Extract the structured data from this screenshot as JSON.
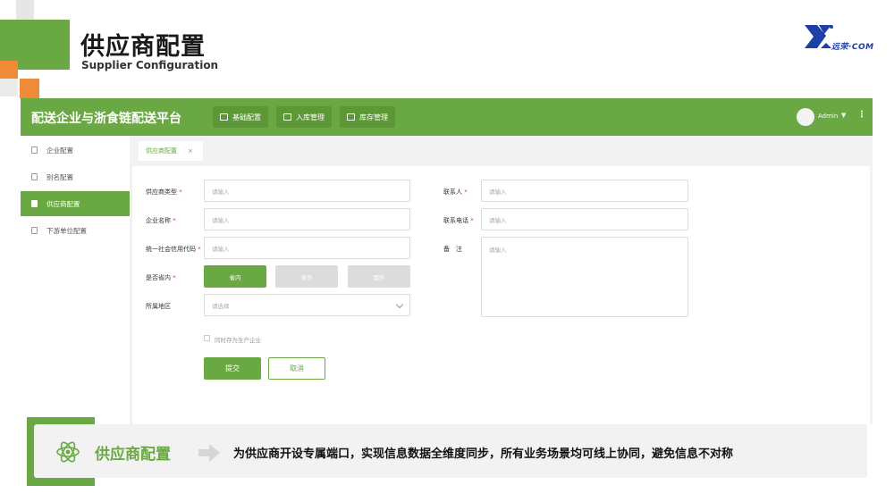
{
  "slide": {
    "title": "供应商配置",
    "subtitle": "Supplier Configuration",
    "logo_text": "远荣·COM"
  },
  "app": {
    "title": "配送企业与浙食链配送平台",
    "top_menu": [
      {
        "label": "基础配置",
        "icon": "doc-icon"
      },
      {
        "label": "入库管理",
        "icon": "inbox-icon"
      },
      {
        "label": "库存管理",
        "icon": "box-icon"
      }
    ],
    "user": "Admin",
    "user_caret": "▼",
    "more": "⋮"
  },
  "sidebar": {
    "items": [
      {
        "label": "企业配置",
        "active": false
      },
      {
        "label": "别名配置",
        "active": false
      },
      {
        "label": "供应商配置",
        "active": true
      },
      {
        "label": "下游单位配置",
        "active": false
      }
    ]
  },
  "tabs": {
    "active_label": "供应商配置",
    "close": "×"
  },
  "form": {
    "supplier_type": {
      "label": "供应商类型",
      "placeholder": "请输入"
    },
    "company_name": {
      "label": "企业名称",
      "placeholder": "请输入"
    },
    "credit_code": {
      "label": "统一社会信用代码",
      "placeholder": "请输入"
    },
    "in_province": {
      "label": "是否省内",
      "options": [
        "省内",
        "省外",
        "国外"
      ]
    },
    "region": {
      "label": "所属地区",
      "placeholder": "请选择"
    },
    "contact": {
      "label": "联系人",
      "placeholder": "请输入"
    },
    "phone": {
      "label": "联系电话",
      "placeholder": "请输入"
    },
    "remark": {
      "label": "备　注",
      "placeholder": "请输入"
    },
    "also_producer": "同时存为生产企业",
    "required_mark": "*",
    "submit": "提交",
    "cancel": "取消"
  },
  "banner": {
    "title": "供应商配置",
    "text": "为供应商开设专属端口，实现信息数据全维度同步，所有业务场景均可线上协同，避免信息不对称"
  },
  "colors": {
    "brand_green": "#6aa843",
    "accent_orange": "#ef8a38",
    "logo_blue": "#1f3fa8"
  }
}
